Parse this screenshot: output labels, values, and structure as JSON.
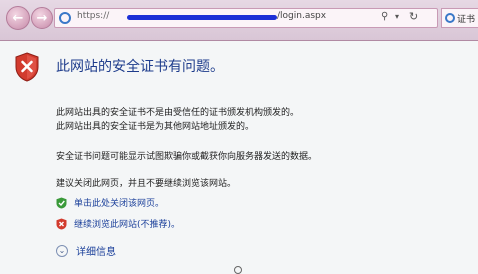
{
  "browser": {
    "url_start": "https://",
    "url_end": "/login.aspx",
    "search_glyph": "⚲",
    "dropdown_glyph": "▾",
    "refresh_glyph": "↻",
    "back_glyph": "←",
    "forward_glyph": "→",
    "tab_label": "证书"
  },
  "page": {
    "title": "此网站的安全证书有问题。",
    "paragraph1_line1": "此网站出具的安全证书不是由受信任的证书颁发机构颁发的。",
    "paragraph1_line2": "此网站出具的安全证书是为其他网站地址颁发的。",
    "paragraph2": "安全证书问题可能显示试图欺骗你或截获你向服务器发送的数据。",
    "paragraph3": "建议关闭此网页，并且不要继续浏览该网站。",
    "option_close": "单击此处关闭该网页。",
    "option_continue": "继续浏览此网站(不推荐)。",
    "details": "详细信息",
    "details_glyph": "⌄"
  },
  "colors": {
    "chrome": "#d9c6d6",
    "title": "#1e3c8c",
    "link": "#1a3f9a",
    "shield_red": "#d23b2e",
    "shield_green": "#3a9a3a"
  }
}
